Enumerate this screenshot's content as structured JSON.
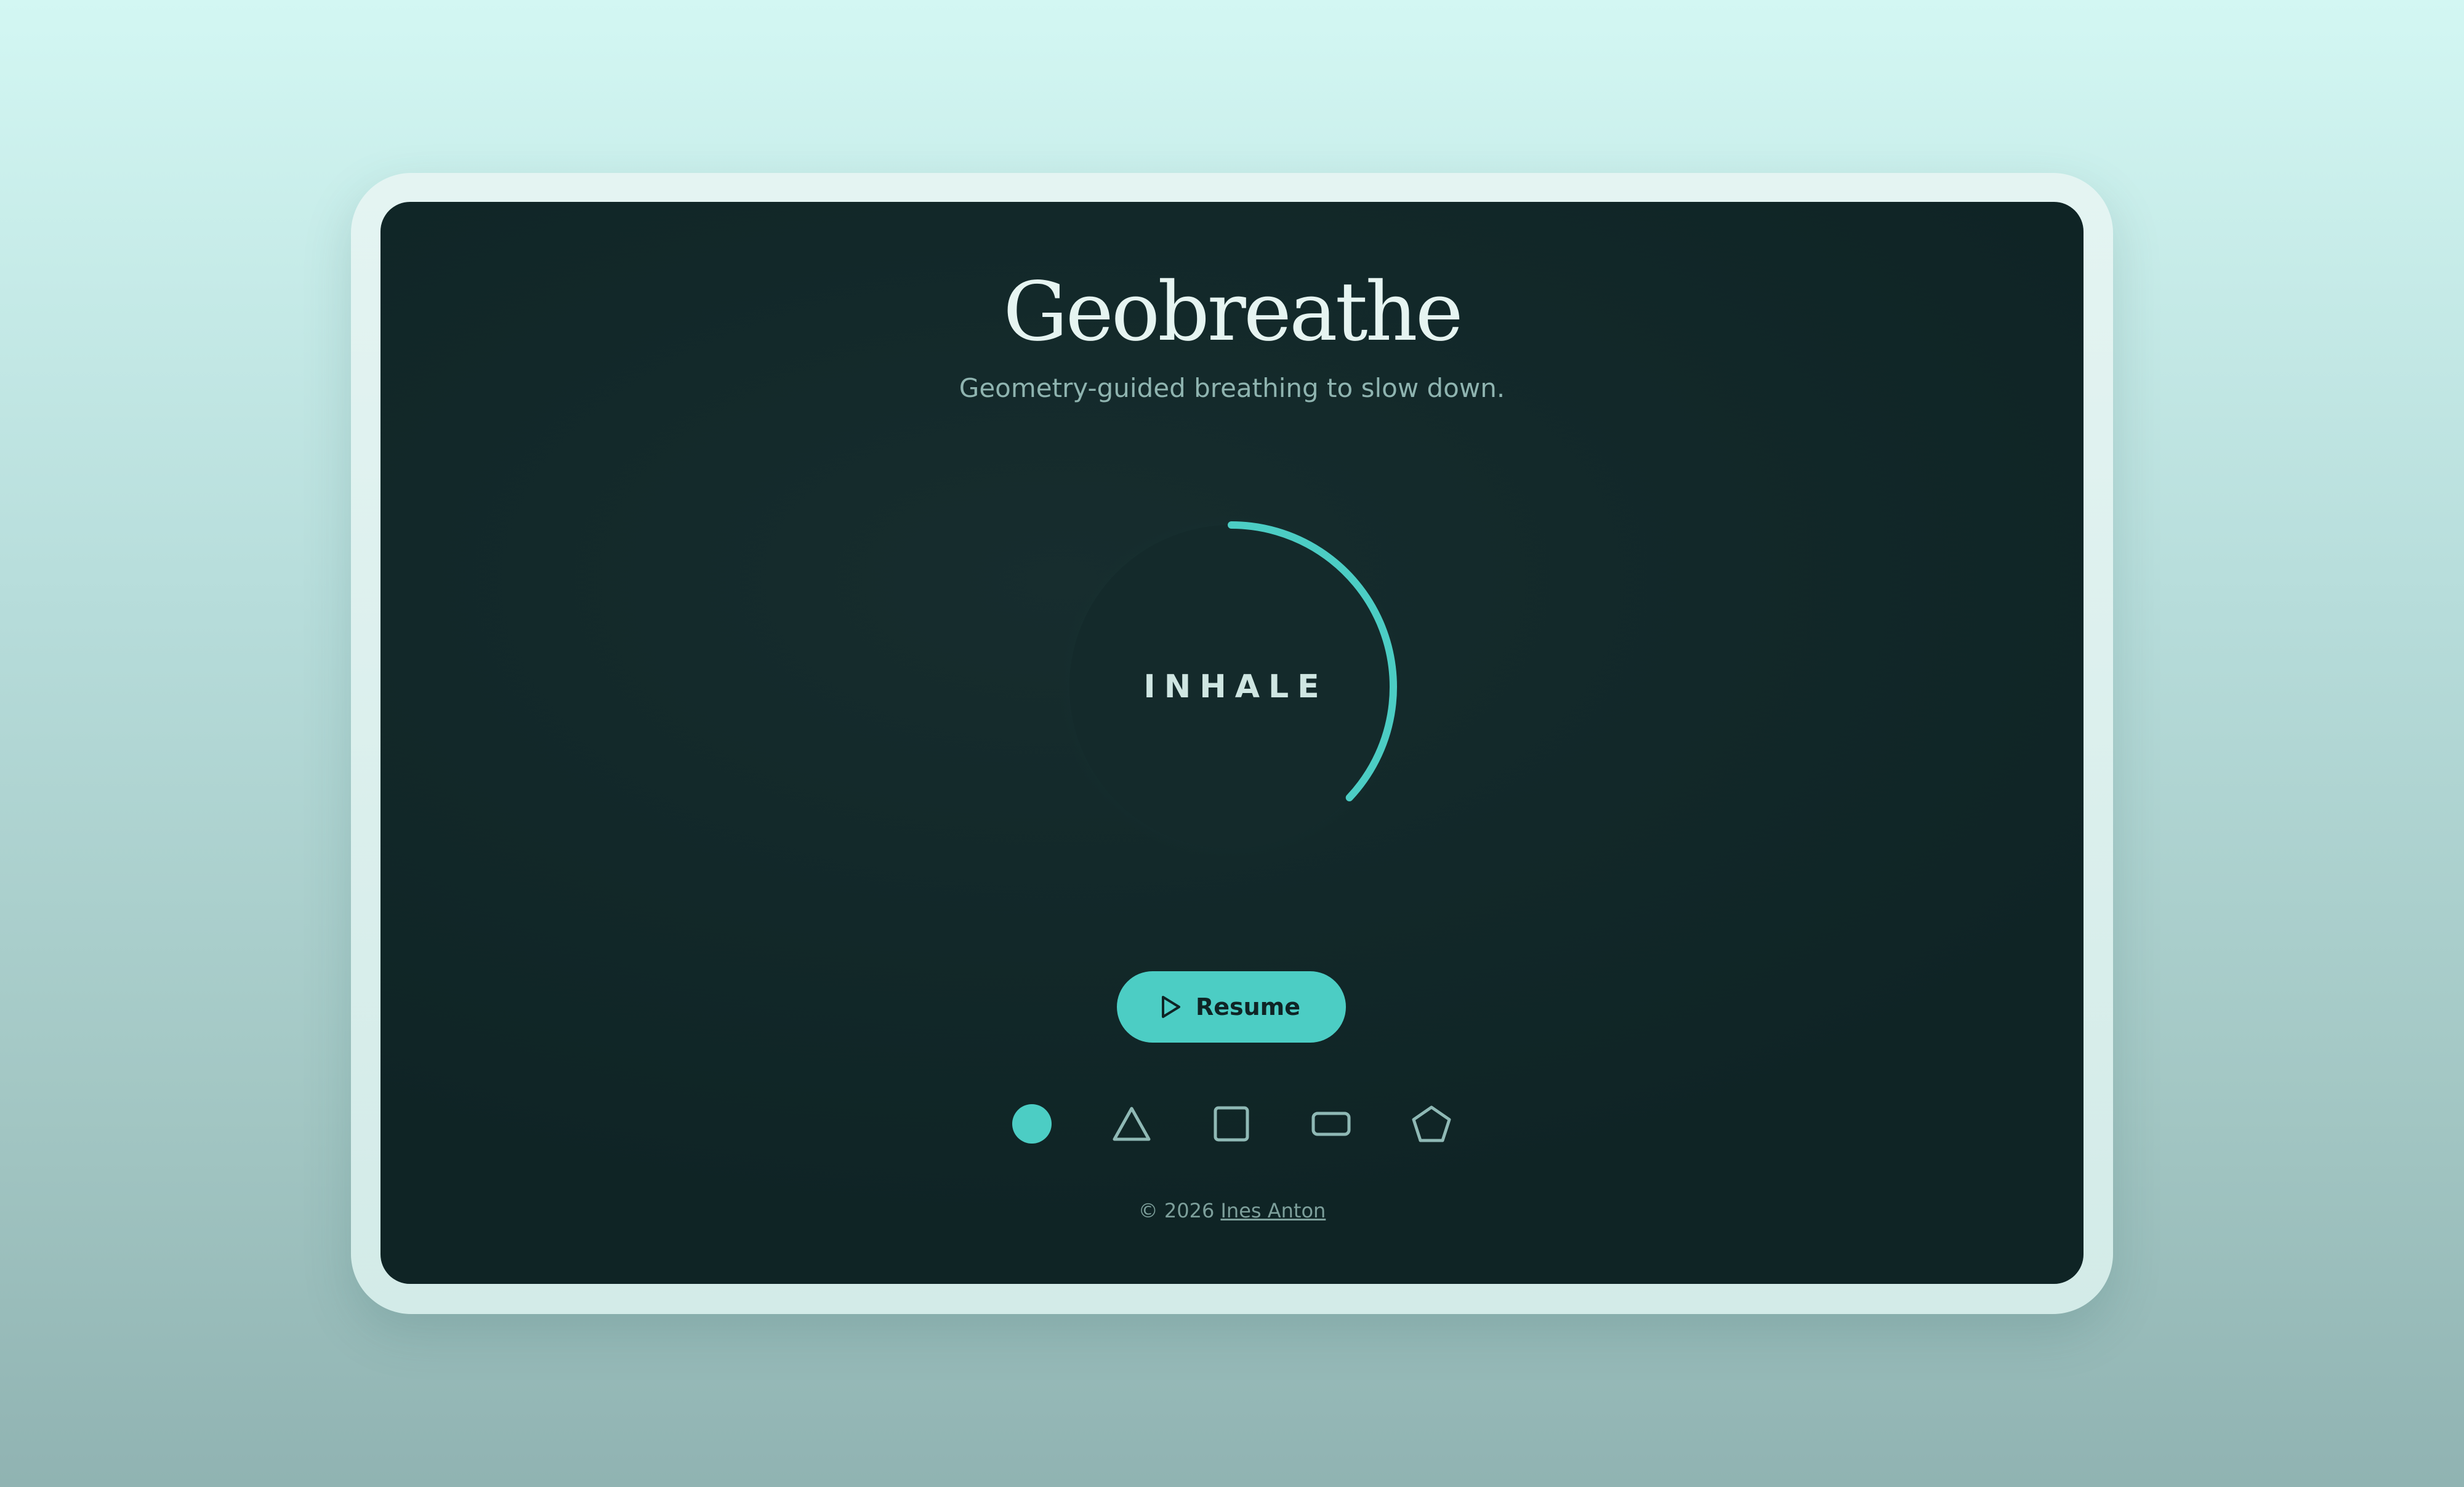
{
  "app": {
    "title": "Geobreathe",
    "subtitle": "Geometry-guided breathing to slow down."
  },
  "breathing": {
    "phase_label": "INHALE",
    "progress": 0.37
  },
  "controls": {
    "resume_label": "Resume",
    "resume_icon": "play-icon"
  },
  "shapes": [
    {
      "name": "circle",
      "icon": "circle-icon",
      "selected": true
    },
    {
      "name": "triangle",
      "icon": "triangle-icon",
      "selected": false
    },
    {
      "name": "square",
      "icon": "square-icon",
      "selected": false
    },
    {
      "name": "rectangle",
      "icon": "rectangle-icon",
      "selected": false
    },
    {
      "name": "pentagon",
      "icon": "pentagon-icon",
      "selected": false
    }
  ],
  "footer": {
    "copyright": "© 2026",
    "author": "Ines Anton"
  },
  "colors": {
    "accent": "#4ccdc4",
    "screen_bg": "#132a2b",
    "title_text": "#e6f4f1",
    "muted_text": "#8fb4b0",
    "shape_outline": "#8fb9b5"
  }
}
